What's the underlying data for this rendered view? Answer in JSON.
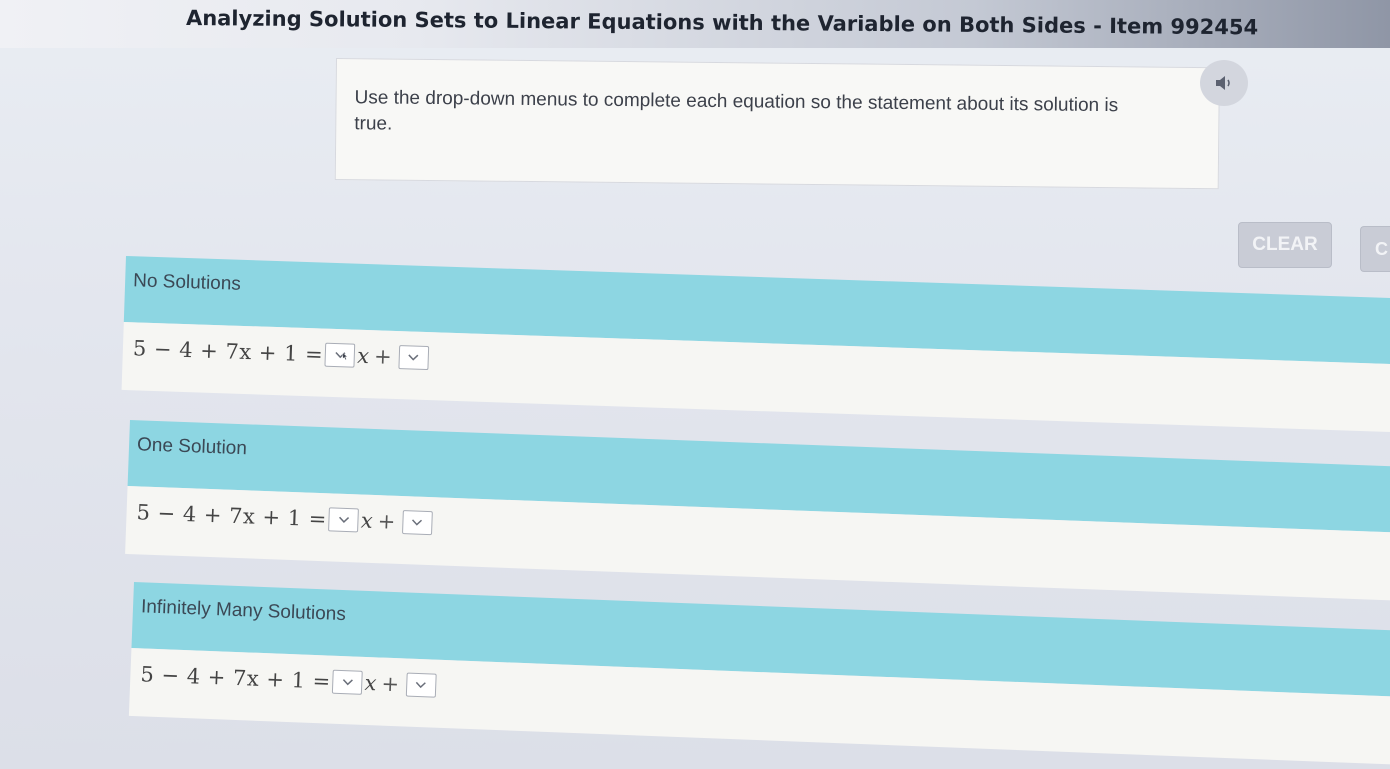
{
  "header": {
    "title": "Analyzing Solution Sets to Linear Equations with the Variable on Both Sides - Item 992454"
  },
  "instructions": {
    "text": "Use the drop-down menus to complete each equation so the statement about its solution is true."
  },
  "toolbar": {
    "audio_icon": "speaker-icon",
    "clear_label": "CLEAR",
    "check_label": "C"
  },
  "sections": [
    {
      "label": "No Solutions",
      "equation": {
        "lhs": "5 − 4 + 7x + 1 =",
        "var": "x",
        "plus": "+"
      }
    },
    {
      "label": "One Solution",
      "equation": {
        "lhs": "5 − 4 + 7x + 1 =",
        "var": "x",
        "plus": "+"
      }
    },
    {
      "label": "Infinitely Many Solutions",
      "equation": {
        "lhs": "5 − 4 + 7x + 1 =",
        "var": "x",
        "plus": "+"
      }
    }
  ],
  "colors": {
    "header_band": "#8dd6e2",
    "body_band": "#f6f6f3",
    "button": "#c9ccd6"
  }
}
